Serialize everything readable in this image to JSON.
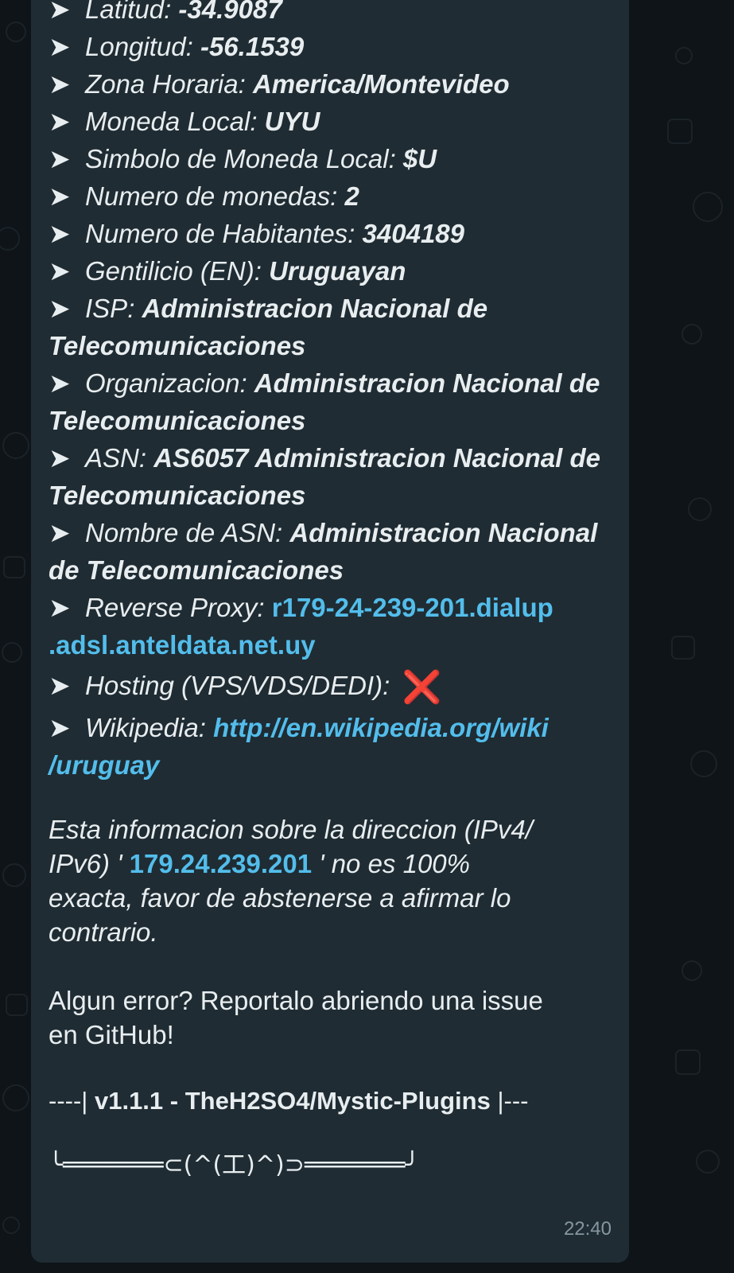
{
  "bubble": {
    "arrow": "➤",
    "rows": [
      {
        "key": "Latitud:",
        "value": "-34.9087"
      },
      {
        "key": "Longitud:",
        "value": "-56.1539"
      },
      {
        "key": "Zona Horaria:",
        "value": "America/Montevideo"
      },
      {
        "key": "Moneda Local:",
        "value": "UYU"
      },
      {
        "key": "Simbolo de Moneda Local:",
        "value": "$U"
      },
      {
        "key": "Numero de monedas:",
        "value": "2"
      },
      {
        "key": "Numero de Habitantes:",
        "value": "3404189"
      },
      {
        "key": "Gentilicio (EN):",
        "value": "Uruguayan"
      },
      {
        "key": "ISP:",
        "value": "Administracion Nacional de Telecomunicaciones"
      },
      {
        "key": "Organizacion:",
        "value": "Administracion Nacional de Telecomunicaciones"
      },
      {
        "key": "ASN:",
        "value": "AS6057 Administracion Nacional de Telecomunicaciones"
      },
      {
        "key": "Nombre de ASN:",
        "value": "Administracion Nacional de Telecomunicaciones"
      }
    ],
    "reverse_proxy": {
      "key": "Reverse Proxy:",
      "link_line1": "r179-24-239-201.dialup",
      "link_line2": ".adsl.anteldata.net.uy"
    },
    "hosting": {
      "key": "Hosting (VPS/VDS/DEDI):",
      "status_icon": "cross-mark-icon",
      "status_color": "#e53935",
      "glyph": "❌"
    },
    "wikipedia": {
      "key": "Wikipedia:",
      "link_line1": "http://en.wikipedia.org/wiki",
      "link_line2": "/uruguay"
    },
    "disclaimer": {
      "line1": "Esta informacion sobre la direccion (IPv4/",
      "line2_pre": "IPv6) ' ",
      "ip": "179.24.239.201",
      "line2_post": " ' no es 100%",
      "line3": "exacta, favor de abstenerse a afirmar lo",
      "line4": "contrario."
    },
    "report": {
      "line1": "Algun error? Reportalo abriendo una issue",
      "line2": "en GitHub!"
    },
    "footer": {
      "prefix": "----| ",
      "text": "v1.1.1 - TheH2SO4/Mystic-Plugins",
      "suffix": " |---"
    },
    "signature": "╰═══════⊂(^(工)^)⊃═══════╯",
    "time": "22:40"
  },
  "colors": {
    "background": "#0e1418",
    "bubble": "#1f2c33",
    "text": "#e8edef",
    "link": "#53bdeb",
    "time": "#8696a0"
  }
}
